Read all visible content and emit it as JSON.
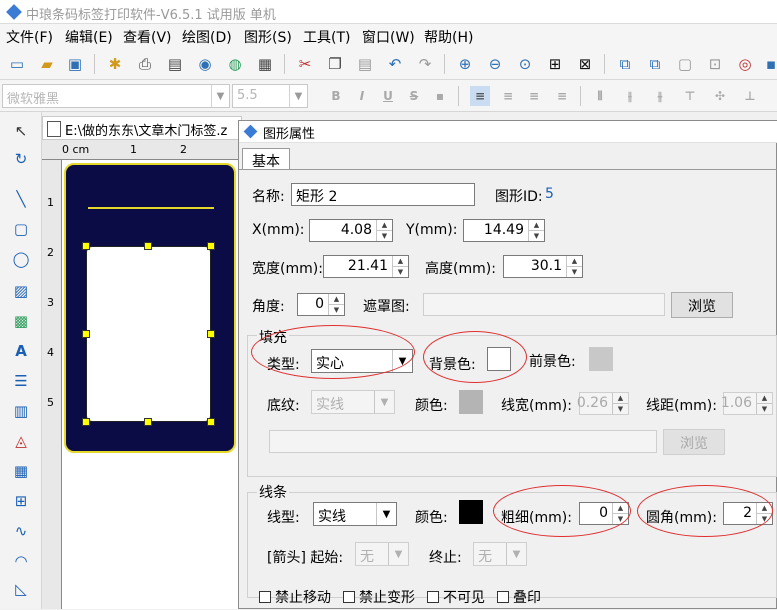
{
  "app": {
    "title": "中琅条码标签打印软件-V6.5.1 试用版 单机"
  },
  "menu": [
    "文件(F)",
    "编辑(E)",
    "查看(V)",
    "绘图(D)",
    "图形(S)",
    "工具(T)",
    "窗口(W)",
    "帮助(H)"
  ],
  "format_bar": {
    "font_name": "微软雅黑",
    "font_size": "5.5"
  },
  "document": {
    "title": "E:\\做的东东\\文章木门标签.z",
    "ruler_labels": [
      "0 cm",
      "1",
      "2"
    ],
    "ruler_v_labels": [
      "1",
      "2",
      "3",
      "4",
      "5"
    ]
  },
  "dialog": {
    "title": "图形属性",
    "tab": "基本",
    "name_label": "名称:",
    "name_value": "矩形 2",
    "shape_id_label": "图形ID:",
    "shape_id_value": "5",
    "x_label": "X(mm):",
    "x_value": "4.08",
    "y_label": "Y(mm):",
    "y_value": "14.49",
    "width_label": "宽度(mm):",
    "width_value": "21.41",
    "height_label": "高度(mm):",
    "height_value": "30.1",
    "angle_label": "角度:",
    "angle_value": "0",
    "mask_label": "遮罩图:",
    "browse_label": "浏览",
    "fill": {
      "title": "填充",
      "type_label": "类型:",
      "type_value": "实心",
      "bg_color_label": "背景色:",
      "fg_color_label": "前景色:",
      "texture_label": "底纹:",
      "texture_value": "实线",
      "color_label": "颜色:",
      "line_width_label": "线宽(mm):",
      "line_width_value": "0.26",
      "line_spacing_label": "线距(mm):",
      "line_spacing_value": "1.06",
      "browse_label": "浏览"
    },
    "line": {
      "title": "线条",
      "type_label": "线型:",
      "type_value": "实线",
      "color_label": "颜色:",
      "thickness_label": "粗细(mm):",
      "thickness_value": "0",
      "corner_label": "圆角(mm):",
      "corner_value": "2",
      "arrow_label": "[箭头] 起始:",
      "arrow_start_value": "无",
      "arrow_end_label": "终止:",
      "arrow_end_value": "无"
    },
    "checkboxes": [
      "禁止移动",
      "禁止变形",
      "不可见",
      "叠印"
    ]
  },
  "colors": {
    "label_background": "#0b0b45",
    "label_border": "#e4d92b",
    "fill_bg_color": "#ffffff",
    "fill_fg_color": "#c8c8c8",
    "texture_color": "#b4b4b4",
    "line_color": "#000000",
    "annotation": "#e03030"
  }
}
